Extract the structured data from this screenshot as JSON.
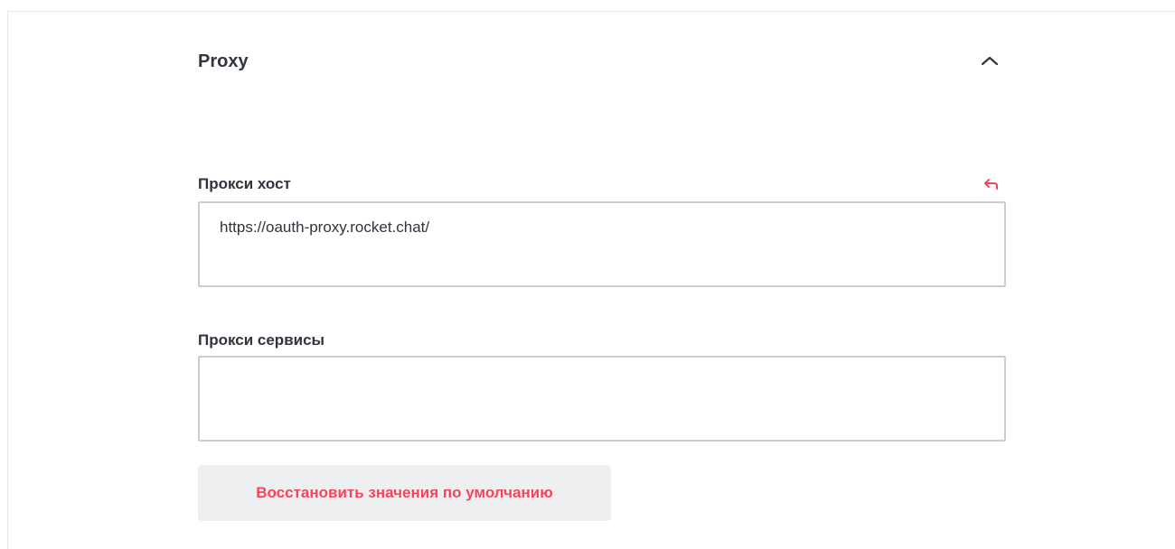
{
  "section": {
    "title": "Proxy",
    "collapse_icon": "chevron-up-icon"
  },
  "fields": {
    "proxy_host": {
      "label": "Прокси хост",
      "value": "https://oauth-proxy.rocket.chat/",
      "reset_icon": "undo-arrow-icon"
    },
    "proxy_services": {
      "label": "Прокси сервисы",
      "value": ""
    }
  },
  "actions": {
    "restore_defaults_label": "Восстановить значения по умолчанию"
  },
  "colors": {
    "accent": "#f5455c",
    "text": "#2f343d",
    "border": "#cbced1",
    "button_bg": "#eeeff1"
  }
}
